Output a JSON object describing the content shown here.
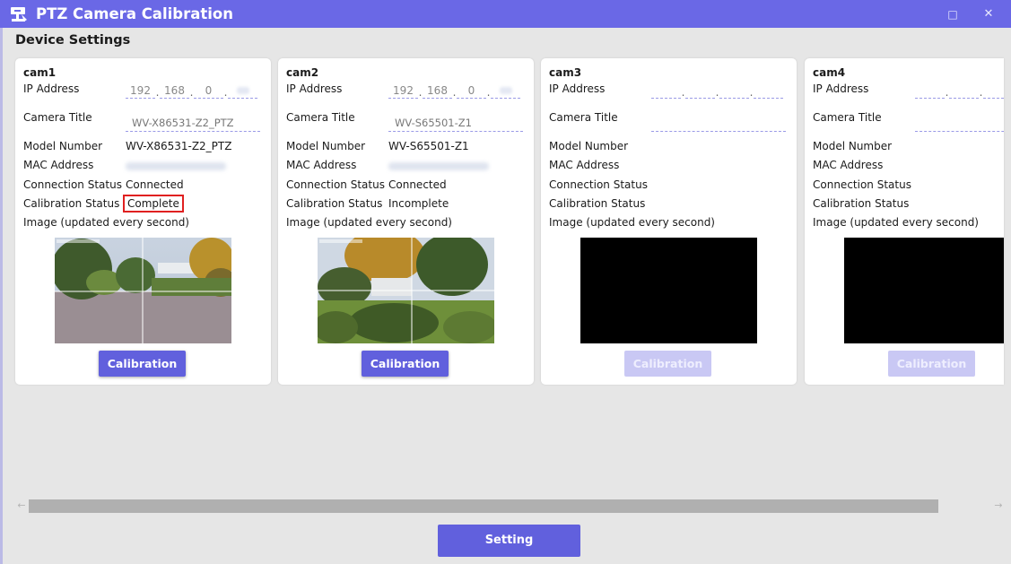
{
  "window": {
    "title": "PTZ Camera Calibration",
    "maximize_glyph": "□",
    "close_glyph": "✕",
    "accent_color": "#6a68e6"
  },
  "section_title": "Device Settings",
  "labels": {
    "ip": "IP Address",
    "title": "Camera Title",
    "model": "Model Number",
    "mac": "MAC Address",
    "connection": "Connection Status",
    "calibration": "Calibration Status",
    "image": "Image (updated every second)"
  },
  "cameras": [
    {
      "name": "cam1",
      "ip": [
        "192",
        "168",
        "0",
        ""
      ],
      "title_value": "WV-X86531-Z2_PTZ",
      "model": "WV-X86531-Z2_PTZ",
      "connection": "Connected",
      "calibration": "Complete",
      "image": "live-feed",
      "button": "Calibration",
      "button_enabled": true
    },
    {
      "name": "cam2",
      "ip": [
        "192",
        "168",
        "0",
        ""
      ],
      "title_value": "WV-S65501-Z1",
      "model": "WV-S65501-Z1",
      "connection": "Connected",
      "calibration": "Incomplete",
      "image": "live-feed",
      "button": "Calibration",
      "button_enabled": true
    },
    {
      "name": "cam3",
      "ip": [
        "",
        "",
        "",
        ""
      ],
      "title_value": "",
      "model": "",
      "connection": "",
      "calibration": "",
      "image": "no-signal",
      "button": "Calibration",
      "button_enabled": false
    },
    {
      "name": "cam4",
      "ip": [
        "",
        "",
        "",
        ""
      ],
      "title_value": "",
      "model": "",
      "connection": "",
      "calibration": "",
      "image": "no-signal",
      "button": "Calibration",
      "button_enabled": false
    }
  ],
  "scrollbar": {
    "left_arrow": "←",
    "right_arrow": "→"
  },
  "footer": {
    "setting_button": "Setting"
  }
}
